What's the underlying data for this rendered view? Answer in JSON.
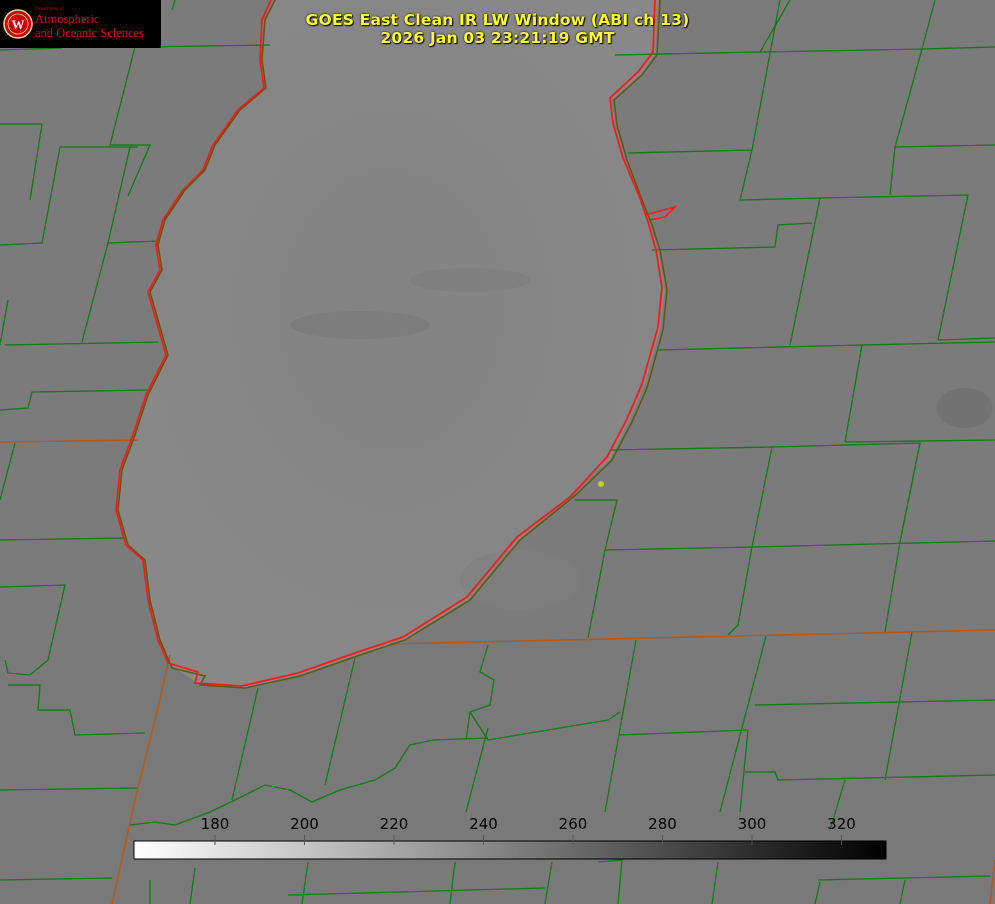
{
  "header": {
    "title_line1": "GOES East Clean IR LW Window (ABI ch 13)",
    "title_line2": "2026 Jan 03 23:21:19 GMT"
  },
  "logo": {
    "small_text": "Department of",
    "line1": "Atmospheric",
    "line2": "and Oceanic Sciences",
    "seal_letter": "W"
  },
  "colorbar": {
    "ticks": [
      "180",
      "200",
      "220",
      "240",
      "260",
      "280",
      "300",
      "320"
    ],
    "colormap": "grayscale, white (cold) to black (warm)"
  },
  "colors": {
    "title": "#ffff33",
    "county_lines": "#0f7a0f",
    "coastline": "#ff1a1a",
    "state_border": "#b45a14",
    "background_land": "#7b7b7b",
    "lake": "#858585",
    "marker": "#cccc20"
  }
}
